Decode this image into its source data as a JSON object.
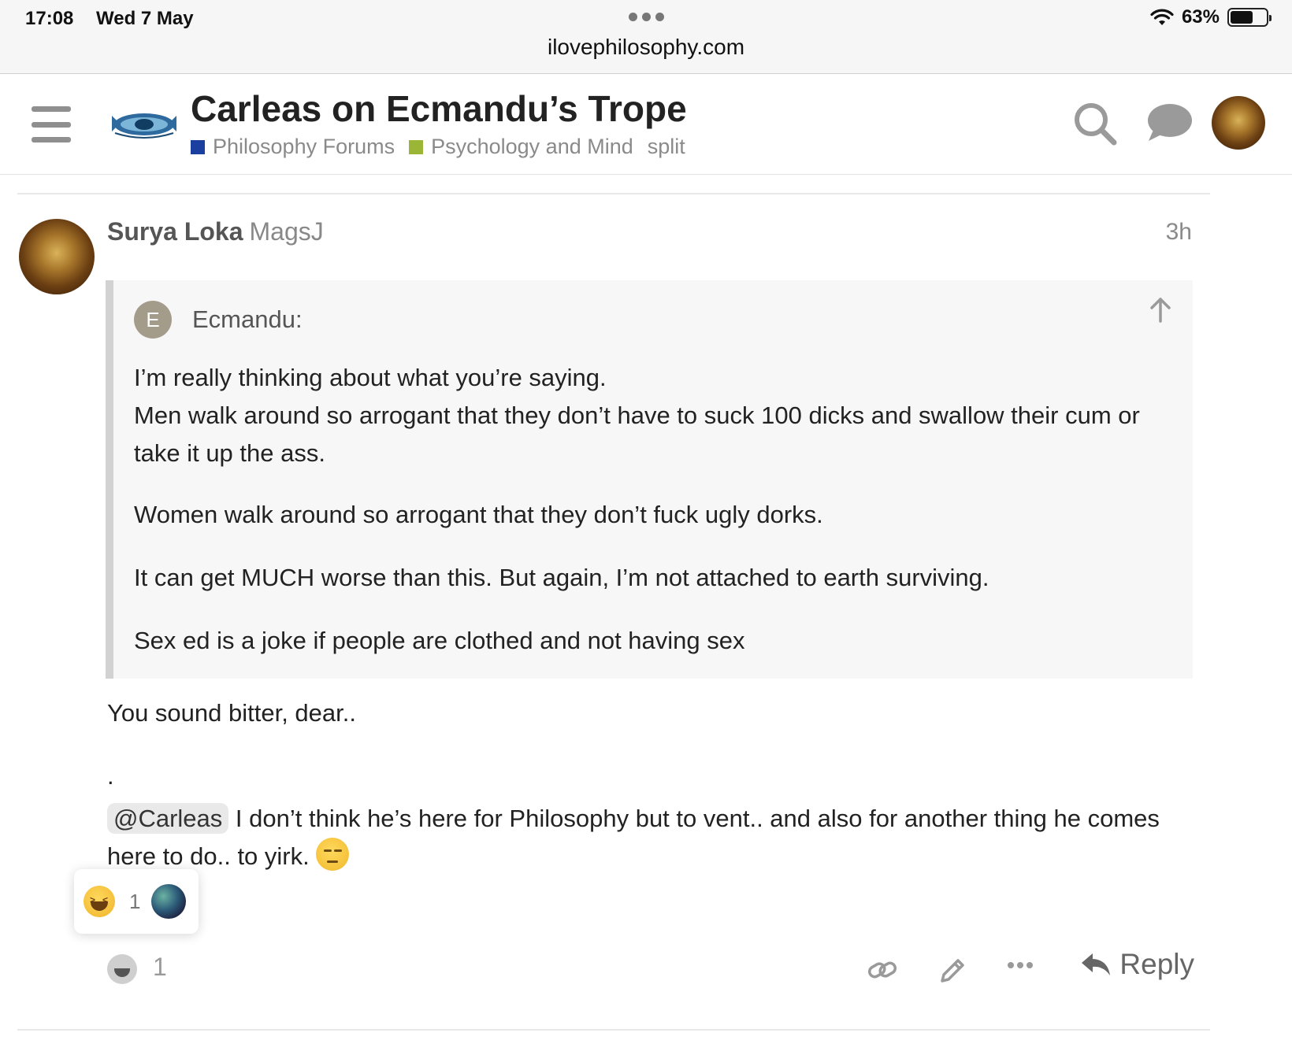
{
  "status_bar": {
    "time": "17:08",
    "date": "Wed 7 May",
    "url": "ilovephilosophy.com",
    "battery": "63%",
    "battery_level": 0.63
  },
  "header": {
    "title": "Carleas on Ecmandu’s Trope",
    "categories": [
      {
        "label": "Philosophy Forums",
        "color": "#1b3f9e"
      },
      {
        "label": "Psychology and Mind",
        "color": "#9bb537"
      }
    ],
    "tag": "split"
  },
  "post": {
    "author_name": "Surya Loka",
    "username": "MagsJ",
    "time": "3h",
    "quote": {
      "avatar_letter": "E",
      "author": "Ecmandu:",
      "paragraphs": [
        "I’m really thinking about what you’re saying.",
        "Men walk around so arrogant that they don’t have to suck 100 dicks and swallow their cum or take it up the ass.",
        "Women walk around so arrogant that they don’t fuck ugly dorks.",
        "It can get MUCH worse than this. But again, I’m not attached to earth surviving.",
        "Sex ed is a joke if people are clothed and not having sex"
      ]
    },
    "reply_line1": "You sound bitter, dear..",
    "reply_dot": ".",
    "mention": "@Carleas",
    "reply_line2": " I don’t think he’s here for Philosophy but to vent.. and also for another thing he comes here to do.. to yirk.",
    "reaction_popup_count": "1",
    "reaction_count": "1",
    "reply_label": "Reply"
  },
  "icons": {
    "menu": "hamburger-icon",
    "search": "search-icon",
    "chat": "chat-icon",
    "link": "link-icon",
    "edit": "pencil-icon",
    "more": "more-icon",
    "reply": "reply-arrow-icon",
    "quote_up": "arrow-up-icon"
  }
}
